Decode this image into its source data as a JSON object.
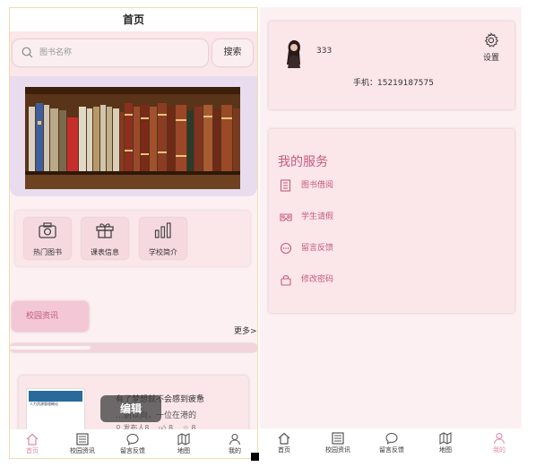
{
  "home": {
    "title": "首页",
    "search": {
      "placeholder": "图书名称",
      "button_label": "搜索"
    },
    "menu": [
      {
        "label": "热门图书",
        "icon": "camera-icon"
      },
      {
        "label": "课表信息",
        "icon": "gift-icon"
      },
      {
        "label": "学校简介",
        "icon": "bar-chart-icon"
      }
    ],
    "news_tab_label": "校园资讯",
    "more_label": "更多>",
    "news_item": {
      "title": "有了梦想就不会感到疲惫",
      "snippet": "…前以向，一位在港的",
      "publisher": "发布人8",
      "likes": "8",
      "favorites": "8",
      "thumb_text": "人力资源管理概论"
    },
    "toast": "编辑"
  },
  "profile": {
    "username": "333",
    "phone": "手机：15219187575",
    "settings_label": "设置",
    "services_title": "我的服务",
    "services": [
      {
        "label": "图书借阅",
        "icon": "book-icon"
      },
      {
        "label": "学生请假",
        "icon": "vr-icon"
      },
      {
        "label": "留言反馈",
        "icon": "chat-icon"
      },
      {
        "label": "修改密码",
        "icon": "lock-icon"
      }
    ]
  },
  "tabbar": [
    {
      "label": "首页",
      "icon": "home-icon"
    },
    {
      "label": "校园资讯",
      "icon": "newspaper-icon"
    },
    {
      "label": "留言反馈",
      "icon": "chat-icon"
    },
    {
      "label": "地图",
      "icon": "map-icon"
    },
    {
      "label": "我的",
      "icon": "user-icon"
    }
  ],
  "colors": {
    "accent": "#c45c7c",
    "active_tab": "#e38aa2",
    "card": "#fbe6ea"
  }
}
